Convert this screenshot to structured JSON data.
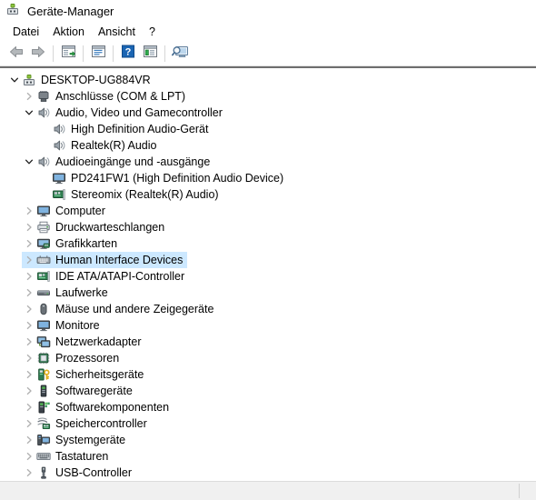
{
  "window": {
    "title": "Geräte-Manager",
    "icon": "device-manager-icon"
  },
  "menubar": {
    "items": [
      {
        "label": "Datei",
        "name": "menu-datei"
      },
      {
        "label": "Aktion",
        "name": "menu-aktion"
      },
      {
        "label": "Ansicht",
        "name": "menu-ansicht"
      },
      {
        "label": "?",
        "name": "menu-hilfe"
      }
    ]
  },
  "toolbar": {
    "buttons": [
      {
        "name": "back-icon",
        "tooltip": "Zurück"
      },
      {
        "name": "forward-icon",
        "tooltip": "Vorwärts"
      },
      {
        "name": "properties-icon",
        "tooltip": "Eigenschaften"
      },
      {
        "name": "show-hidden-devices-icon",
        "tooltip": "Ausgeblendete Geräte anzeigen"
      },
      {
        "name": "help-icon",
        "tooltip": "Hilfe"
      },
      {
        "name": "update-driver-icon",
        "tooltip": "Treiber aktualisieren"
      },
      {
        "name": "scan-hardware-changes-icon",
        "tooltip": "Nach geänderter Hardware suchen"
      }
    ]
  },
  "statusbar": {
    "text": ""
  },
  "colors": {
    "selection": "#cce8ff",
    "window_background": "#ffffff",
    "statusbar_background": "#f0f0f0",
    "accent_blue": "#1b65b3",
    "icon_gray": "#5a5a5a"
  },
  "tree": {
    "nodes": [
      {
        "label": "DESKTOP-UG884VR",
        "level": 0,
        "state": "expanded",
        "icon": "computer-root-icon",
        "selected": false,
        "name": "tree-node-desktop-ug884vr"
      },
      {
        "label": "Anschlüsse (COM & LPT)",
        "level": 1,
        "state": "collapsed",
        "icon": "port-icon",
        "selected": false,
        "name": "tree-node-anschluesse"
      },
      {
        "label": "Audio, Video und Gamecontroller",
        "level": 1,
        "state": "expanded",
        "icon": "speaker-icon",
        "selected": false,
        "name": "tree-node-audio-video-gamecontroller"
      },
      {
        "label": "High Definition Audio-Gerät",
        "level": 2,
        "state": "leaf",
        "icon": "speaker-icon",
        "selected": false,
        "name": "tree-node-high-definition-audio-geraet"
      },
      {
        "label": "Realtek(R) Audio",
        "level": 2,
        "state": "leaf",
        "icon": "speaker-icon",
        "selected": false,
        "name": "tree-node-realtek-audio"
      },
      {
        "label": "Audioeingänge und -ausgänge",
        "level": 1,
        "state": "expanded",
        "icon": "speaker-icon",
        "selected": false,
        "name": "tree-node-audioeingaenge-und-ausgaenge"
      },
      {
        "label": "PD241FW1 (High Definition Audio Device)",
        "level": 2,
        "state": "leaf",
        "icon": "monitor-icon",
        "selected": false,
        "name": "tree-node-pd241fw1"
      },
      {
        "label": "Stereomix (Realtek(R) Audio)",
        "level": 2,
        "state": "leaf",
        "icon": "sound-card-icon",
        "selected": false,
        "name": "tree-node-stereomix"
      },
      {
        "label": "Computer",
        "level": 1,
        "state": "collapsed",
        "icon": "monitor-icon",
        "selected": false,
        "name": "tree-node-computer"
      },
      {
        "label": "Druckwarteschlangen",
        "level": 1,
        "state": "collapsed",
        "icon": "printer-icon",
        "selected": false,
        "name": "tree-node-druckwarteschlangen"
      },
      {
        "label": "Grafikkarten",
        "level": 1,
        "state": "collapsed",
        "icon": "graphics-card-icon",
        "selected": false,
        "name": "tree-node-grafikkarten"
      },
      {
        "label": "Human Interface Devices",
        "level": 1,
        "state": "collapsed",
        "icon": "hid-icon",
        "selected": true,
        "name": "tree-node-human-interface-devices"
      },
      {
        "label": "IDE ATA/ATAPI-Controller",
        "level": 1,
        "state": "collapsed",
        "icon": "ide-controller-icon",
        "selected": false,
        "name": "tree-node-ide-ata-atapi-controller"
      },
      {
        "label": "Laufwerke",
        "level": 1,
        "state": "collapsed",
        "icon": "disk-drive-icon",
        "selected": false,
        "name": "tree-node-laufwerke"
      },
      {
        "label": "Mäuse und andere Zeigegeräte",
        "level": 1,
        "state": "collapsed",
        "icon": "mouse-icon",
        "selected": false,
        "name": "tree-node-maeuse-und-andere-zeigegeraete"
      },
      {
        "label": "Monitore",
        "level": 1,
        "state": "collapsed",
        "icon": "monitor-icon",
        "selected": false,
        "name": "tree-node-monitore"
      },
      {
        "label": "Netzwerkadapter",
        "level": 1,
        "state": "collapsed",
        "icon": "network-adapter-icon",
        "selected": false,
        "name": "tree-node-netzwerkadapter"
      },
      {
        "label": "Prozessoren",
        "level": 1,
        "state": "collapsed",
        "icon": "processor-icon",
        "selected": false,
        "name": "tree-node-prozessoren"
      },
      {
        "label": "Sicherheitsgeräte",
        "level": 1,
        "state": "collapsed",
        "icon": "security-device-icon",
        "selected": false,
        "name": "tree-node-sicherheitsgeraete"
      },
      {
        "label": "Softwaregeräte",
        "level": 1,
        "state": "collapsed",
        "icon": "software-device-icon",
        "selected": false,
        "name": "tree-node-softwaregeraete"
      },
      {
        "label": "Softwarekomponenten",
        "level": 1,
        "state": "collapsed",
        "icon": "software-component-icon",
        "selected": false,
        "name": "tree-node-softwarekomponenten"
      },
      {
        "label": "Speichercontroller",
        "level": 1,
        "state": "collapsed",
        "icon": "storage-controller-icon",
        "selected": false,
        "name": "tree-node-speichercontroller"
      },
      {
        "label": "Systemgeräte",
        "level": 1,
        "state": "collapsed",
        "icon": "system-device-icon",
        "selected": false,
        "name": "tree-node-systemgeraete"
      },
      {
        "label": "Tastaturen",
        "level": 1,
        "state": "collapsed",
        "icon": "keyboard-icon",
        "selected": false,
        "name": "tree-node-tastaturen"
      },
      {
        "label": "USB-Controller",
        "level": 1,
        "state": "collapsed",
        "icon": "usb-icon",
        "selected": false,
        "name": "tree-node-usb-controller"
      }
    ]
  }
}
